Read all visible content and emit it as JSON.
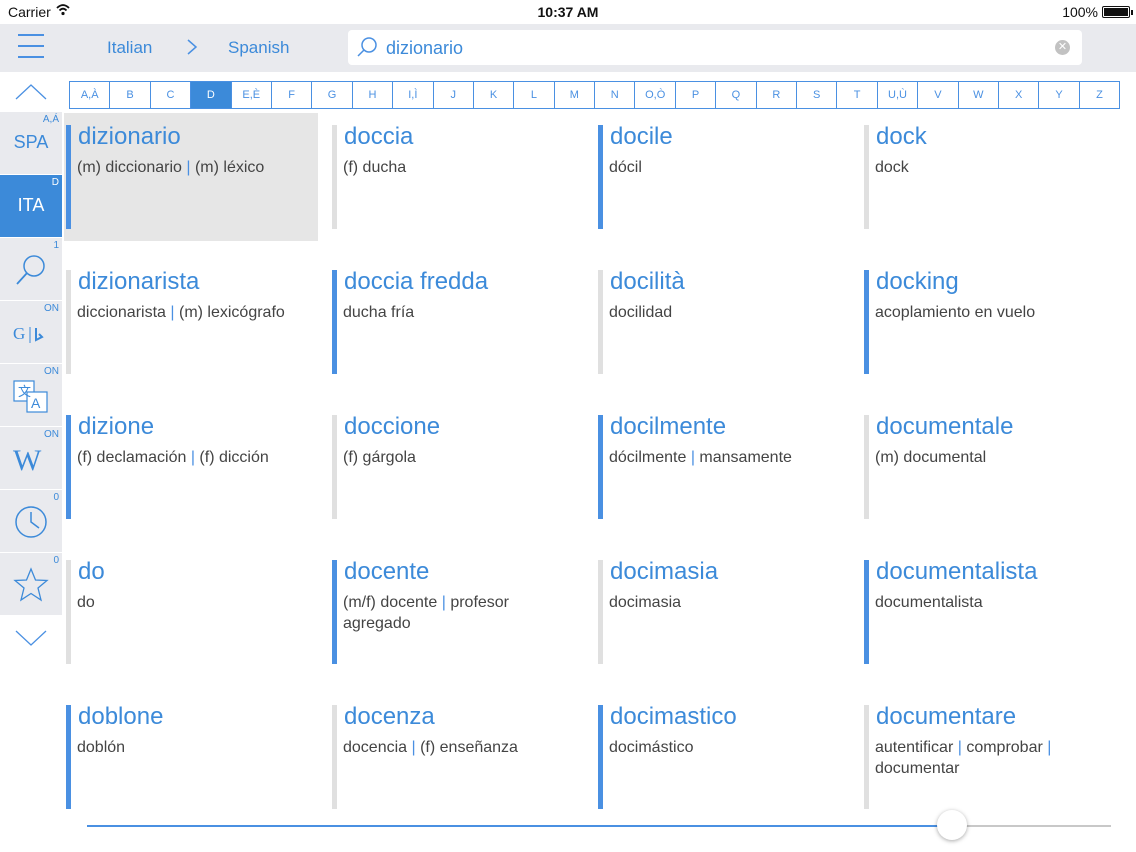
{
  "status": {
    "carrier": "Carrier",
    "time": "10:37 AM",
    "battery": "100%"
  },
  "header": {
    "from_lang": "Italian",
    "to_lang": "Spanish",
    "search_value": "dizionario"
  },
  "alphabet": [
    "A,À",
    "B",
    "C",
    "D",
    "E,È",
    "F",
    "G",
    "H",
    "I,Ì",
    "J",
    "K",
    "L",
    "M",
    "N",
    "O,Ò",
    "P",
    "Q",
    "R",
    "S",
    "T",
    "U,Ù",
    "V",
    "W",
    "X",
    "Y",
    "Z"
  ],
  "alphabet_active": "D",
  "sidebar": {
    "spa": {
      "label": "SPA",
      "sup": "A,Á"
    },
    "ita": {
      "label": "ITA",
      "sup": "D"
    },
    "search_count": "1",
    "google_bing": "ON",
    "translate": "ON",
    "wiki": "ON",
    "history_count": "0",
    "favorites_count": "0"
  },
  "slider": {
    "value": 0.845
  },
  "entries": [
    {
      "word": "dizionario",
      "trans": [
        "(m) diccionario",
        "(m) léxico"
      ],
      "bar": "blue",
      "selected": true
    },
    {
      "word": "doccia",
      "trans": [
        "(f) ducha"
      ],
      "bar": "grey"
    },
    {
      "word": "docile",
      "trans": [
        "dócil"
      ],
      "bar": "blue"
    },
    {
      "word": "dock",
      "trans": [
        "dock"
      ],
      "bar": "grey"
    },
    {
      "word": "dizionarista",
      "trans": [
        "diccionarista",
        "(m) lexicógrafo"
      ],
      "bar": "grey"
    },
    {
      "word": "doccia fredda",
      "trans": [
        "ducha fría"
      ],
      "bar": "blue"
    },
    {
      "word": "docilità",
      "trans": [
        "docilidad"
      ],
      "bar": "grey"
    },
    {
      "word": "docking",
      "trans": [
        "acoplamiento en vuelo"
      ],
      "bar": "blue"
    },
    {
      "word": "dizione",
      "trans": [
        "(f) declamación",
        "(f) dicción"
      ],
      "bar": "blue"
    },
    {
      "word": "doccione",
      "trans": [
        "(f) gárgola"
      ],
      "bar": "grey"
    },
    {
      "word": "docilmente",
      "trans": [
        "dócilmente",
        "mansamente"
      ],
      "bar": "blue"
    },
    {
      "word": "documentale",
      "trans": [
        "(m) documental"
      ],
      "bar": "grey"
    },
    {
      "word": "do",
      "trans": [
        "do"
      ],
      "bar": "grey"
    },
    {
      "word": "docente",
      "trans": [
        "(m/f) docente",
        "profesor agregado"
      ],
      "bar": "blue"
    },
    {
      "word": "docimasia",
      "trans": [
        "docimasia"
      ],
      "bar": "grey"
    },
    {
      "word": "documentalista",
      "trans": [
        "documentalista"
      ],
      "bar": "blue"
    },
    {
      "word": "doblone",
      "trans": [
        "doblón"
      ],
      "bar": "blue"
    },
    {
      "word": "docenza",
      "trans": [
        "docencia",
        "(f) enseñanza"
      ],
      "bar": "grey"
    },
    {
      "word": "docimastico",
      "trans": [
        "docimástico"
      ],
      "bar": "blue"
    },
    {
      "word": "documentare",
      "trans": [
        "autentificar",
        "comprobar",
        "documentar"
      ],
      "bar": "grey"
    }
  ]
}
